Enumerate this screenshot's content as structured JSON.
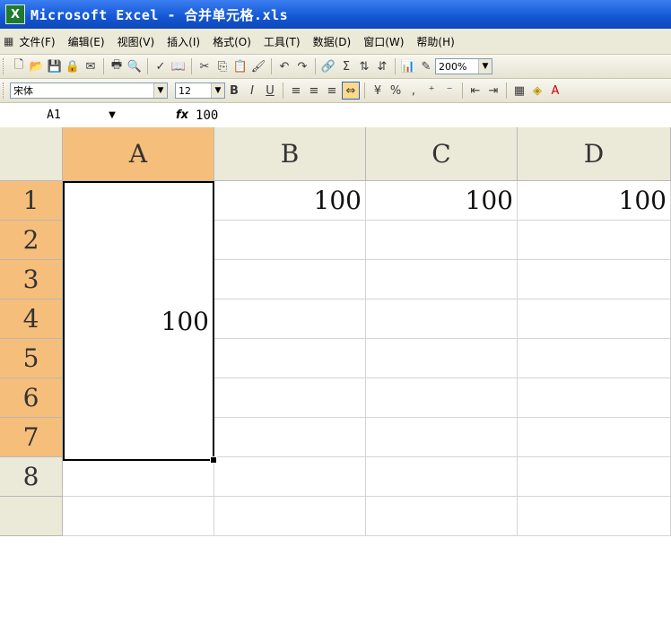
{
  "window": {
    "title": "Microsoft Excel - 合并单元格.xls",
    "app_icon": "excel-icon"
  },
  "menu": {
    "items": [
      "文件(F)",
      "编辑(E)",
      "视图(V)",
      "插入(I)",
      "格式(O)",
      "工具(T)",
      "数据(D)",
      "窗口(W)",
      "帮助(H)"
    ]
  },
  "standard_toolbar": {
    "zoom": "200%"
  },
  "formatting_toolbar": {
    "font": "宋体",
    "font_size": "12"
  },
  "formula_bar": {
    "name_box": "A1",
    "fx_label": "fx",
    "value": "100"
  },
  "grid": {
    "columns": [
      "A",
      "B",
      "C",
      "D"
    ],
    "rows": [
      "1",
      "2",
      "3",
      "4",
      "5",
      "6",
      "7",
      "8"
    ],
    "cells": {
      "A1_merged": "100",
      "B1": "100",
      "C1": "100",
      "D1": "100"
    }
  }
}
